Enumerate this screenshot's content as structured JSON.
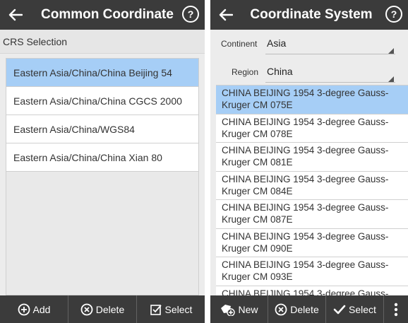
{
  "left": {
    "header_title": "Common Coordinate",
    "help_label": "?",
    "section_label": "CRS Selection",
    "items": [
      "Eastern Asia/China/China Beijing 54",
      "Eastern Asia/China/China CGCS 2000",
      "Eastern Asia/China/WGS84",
      "Eastern Asia/China/China Xian 80"
    ],
    "selected_index": 0,
    "toolbar": {
      "add": "Add",
      "delete": "Delete",
      "select": "Select"
    }
  },
  "right": {
    "header_title": "Coordinate System",
    "help_label": "?",
    "continent_label": "Continent",
    "continent_value": "Asia",
    "region_label": "Region",
    "region_value": "China",
    "items": [
      "CHINA BEIJING 1954 3-degree Gauss-Kruger CM 075E",
      "CHINA BEIJING 1954 3-degree Gauss-Kruger CM 078E",
      "CHINA BEIJING 1954 3-degree Gauss-Kruger CM 081E",
      "CHINA BEIJING 1954 3-degree Gauss-Kruger CM 084E",
      "CHINA BEIJING 1954 3-degree Gauss-Kruger CM 087E",
      "CHINA BEIJING 1954 3-degree Gauss-Kruger CM 090E",
      "CHINA BEIJING 1954 3-degree Gauss-Kruger CM 093E",
      "CHINA BEIJING 1954 3-degree Gauss-"
    ],
    "selected_index": 0,
    "toolbar": {
      "new": "New",
      "delete": "Delete",
      "select": "Select"
    }
  },
  "colors": {
    "header": "#3b3b3b",
    "selected": "#a6cef6",
    "background": "#ececec"
  },
  "icons": [
    "back-arrow-icon",
    "help-icon",
    "add-circle-icon",
    "delete-circle-icon",
    "select-check-icon",
    "new-icon",
    "check-icon",
    "more-vert-icon"
  ]
}
